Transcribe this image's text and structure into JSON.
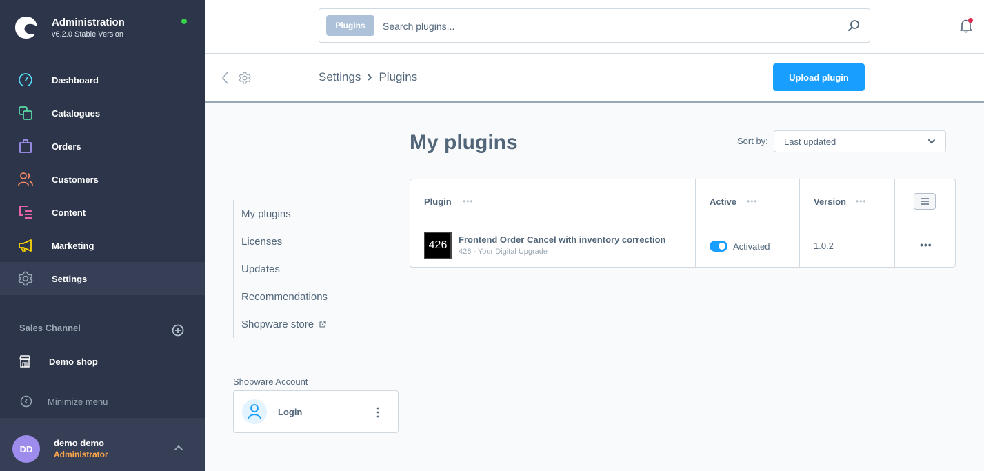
{
  "app": {
    "title": "Administration",
    "version": "v6.2.0 Stable Version",
    "status_color": "#37d046"
  },
  "sidebar": {
    "items": [
      {
        "label": "Dashboard",
        "icon": "dashboard-icon",
        "color": "#57d9f5"
      },
      {
        "label": "Catalogues",
        "icon": "catalogues-icon",
        "color": "#57d9a3"
      },
      {
        "label": "Orders",
        "icon": "orders-icon",
        "color": "#a092f0"
      },
      {
        "label": "Customers",
        "icon": "customers-icon",
        "color": "#f88962"
      },
      {
        "label": "Content",
        "icon": "content-icon",
        "color": "#ff68b4"
      },
      {
        "label": "Marketing",
        "icon": "marketing-icon",
        "color": "#ffd700"
      },
      {
        "label": "Settings",
        "icon": "settings-icon",
        "color": "#9aa8b5",
        "active": true
      }
    ],
    "sales_channel": {
      "header": "Sales Channel",
      "items": [
        {
          "label": "Demo shop",
          "icon": "storefront-icon"
        }
      ]
    },
    "minimize_label": "Minimize menu",
    "user": {
      "initials": "DD",
      "name": "demo demo",
      "role": "Administrator"
    }
  },
  "search": {
    "type_label": "Plugins",
    "placeholder": "Search plugins...",
    "value": ""
  },
  "notifications": {
    "has_unread": true
  },
  "smartbar": {
    "breadcrumb": [
      "Settings",
      "Plugins"
    ],
    "upload_label": "Upload plugin"
  },
  "plugin_nav": {
    "items": [
      {
        "label": "My plugins"
      },
      {
        "label": "Licenses"
      },
      {
        "label": "Updates"
      },
      {
        "label": "Recommendations"
      },
      {
        "label": "Shopware store",
        "external": true
      }
    ]
  },
  "account": {
    "label": "Shopware Account",
    "login_label": "Login"
  },
  "main": {
    "title": "My plugins",
    "sort_label": "Sort by:",
    "sort_value": "Last updated",
    "grid": {
      "columns": [
        "Plugin",
        "Active",
        "Version"
      ],
      "rows": [
        {
          "icon_text": "426",
          "name": "Frontend Order Cancel with inventory correction",
          "vendor": "426 - Your Digital Upgrade",
          "active": true,
          "active_label": "Activated",
          "version": "1.0.2"
        }
      ]
    }
  }
}
